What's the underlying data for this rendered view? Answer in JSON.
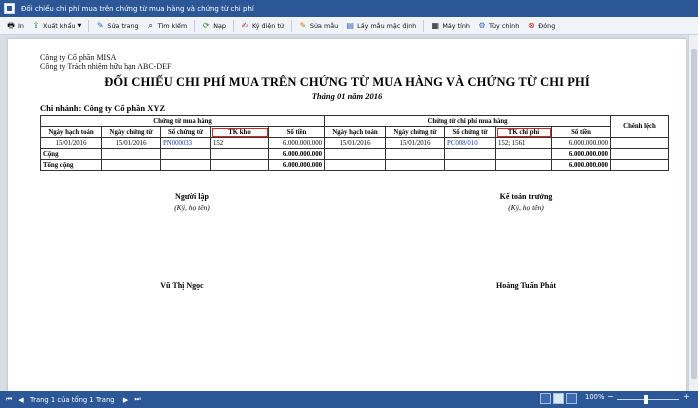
{
  "window": {
    "title": "Đối chiếu chi phí mua trên chứng từ mua hàng và chứng từ chi phí"
  },
  "toolbar": {
    "print": "In",
    "export": "Xuất khẩu",
    "edit_page": "Sửa trang",
    "find": "Tìm kiếm",
    "load": "Nạp",
    "signature": "Ký điện tử",
    "edit_template": "Sửa mẫu",
    "default_template": "Lấy mẫu mặc định",
    "calculator": "Máy tính",
    "options": "Tùy chỉnh",
    "close": "Đóng"
  },
  "report": {
    "company_parent": "Công ty Cổ phần MISA",
    "company_child": "Công ty Trách nhiệm hữu hạn ABC-DEF",
    "title": "ĐỐI CHIẾU CHI PHÍ MUA TRÊN CHỨNG TỪ MUA HÀNG VÀ CHỨNG TỪ CHI PHÍ",
    "period": "Tháng 01 năm 2016",
    "branch": "Chi nhánh: Công ty Cổ phần XYZ",
    "group_purchase": "Chứng từ mua hàng",
    "group_cost": "Chứng từ chi phí mua hàng",
    "col_difference": "Chênh lệch",
    "cols_purchase": [
      "Ngày hạch toán",
      "Ngày chứng từ",
      "Số chứng từ",
      "TK kho",
      "Số tiền"
    ],
    "cols_cost": [
      "Ngày hạch toán",
      "Ngày chứng từ",
      "Số chứng từ",
      "TK chi phí",
      "Số tiền"
    ],
    "row": {
      "p_post_date": "15/01/2016",
      "p_doc_date": "15/01/2016",
      "p_doc_no": "PN000033",
      "p_account": "152",
      "p_amount": "6.000.000.000",
      "c_post_date": "15/01/2016",
      "c_doc_date": "15/01/2016",
      "c_doc_no": "PC008/010",
      "c_account": "152; 1561",
      "c_amount": "6.000.000.000",
      "difference": ""
    },
    "subtotal": {
      "label": "Cộng",
      "p_amount": "6.000.000.000",
      "c_amount": "6.000.000.000"
    },
    "total": {
      "label": "Tổng cộng",
      "p_amount": "6.000.000.000",
      "c_amount": "6.000.000.000"
    },
    "sign_left": {
      "role": "Người lập",
      "hint": "(Ký, họ tên)",
      "name": "Vũ Thị Ngọc"
    },
    "sign_right": {
      "role": "Kế toán trưởng",
      "hint": "(Ký, họ tên)",
      "name": "Hoàng Tuấn Phát"
    }
  },
  "status": {
    "page_info": "Trang 1 của tổng 1 Trang",
    "zoom": "100%"
  },
  "colors": {
    "titlebar": "#2b5797",
    "highlight": "#d62a2a",
    "link": "#1a3fb4"
  }
}
